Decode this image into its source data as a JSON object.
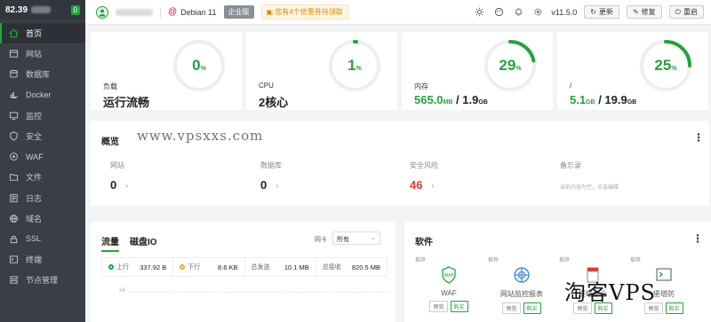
{
  "sidebar": {
    "ip": "82.39",
    "badge": "0",
    "items": [
      {
        "label": "首页",
        "icon": "home-icon"
      },
      {
        "label": "网站",
        "icon": "globe-icon"
      },
      {
        "label": "数据库",
        "icon": "database-icon"
      },
      {
        "label": "Docker",
        "icon": "docker-icon"
      },
      {
        "label": "监控",
        "icon": "monitor-icon"
      },
      {
        "label": "安全",
        "icon": "shield-icon"
      },
      {
        "label": "WAF",
        "icon": "waf-icon"
      },
      {
        "label": "文件",
        "icon": "folder-icon"
      },
      {
        "label": "日志",
        "icon": "log-icon"
      },
      {
        "label": "域名",
        "icon": "domain-icon"
      },
      {
        "label": "SSL",
        "icon": "ssl-icon"
      },
      {
        "label": "终端",
        "icon": "terminal-icon"
      },
      {
        "label": "节点管理",
        "icon": "node-icon"
      }
    ]
  },
  "topbar": {
    "os": "Debian 11",
    "edition": "企业版",
    "notice": "您有4个优惠券待领取",
    "version": "v11.5.0",
    "update": "更新",
    "repair": "修复",
    "restart": "重启"
  },
  "stats": {
    "load": {
      "label": "负载",
      "value": "运行流畅",
      "percent": "0",
      "unit": "%"
    },
    "cpu": {
      "label": "CPU",
      "value": "2核心",
      "percent": "1",
      "unit": "%"
    },
    "memory": {
      "label": "内存",
      "used": "565.0",
      "used_unit": "MB",
      "sep": " / ",
      "total": "1.9",
      "total_unit": "GB",
      "percent": "29",
      "unit": "%"
    },
    "disk": {
      "label": "/",
      "used": "5.1",
      "used_unit": "GB",
      "sep": " / ",
      "total": "19.9",
      "total_unit": "GB",
      "percent": "25",
      "unit": "%"
    }
  },
  "overview": {
    "title": "概览",
    "watermark": "www.vpsxxs.com",
    "items": [
      {
        "label": "网站",
        "value": "0"
      },
      {
        "label": "数据库",
        "value": "0"
      },
      {
        "label": "安全风险",
        "value": "46"
      },
      {
        "label": "备忘录",
        "hint": "当前内容为空，点击编辑"
      }
    ]
  },
  "traffic": {
    "tab_traffic": "流量",
    "tab_disk": "磁盘IO",
    "nic_label": "网卡",
    "nic_value": "所有",
    "up_label": "上行",
    "up_value": "337.92 B",
    "down_label": "下行",
    "down_value": "8.6 KB",
    "sent_label": "总发送",
    "sent_value": "10.1 MB",
    "recv_label": "总接收",
    "recv_value": "820.5 MB",
    "axis_tick": "24"
  },
  "software": {
    "title": "软件",
    "recommend": "推荐",
    "items": [
      {
        "name": "WAF",
        "preview": "预览",
        "buy": "购买"
      },
      {
        "name": "网站监控报表",
        "preview": "预览",
        "buy": "购买"
      },
      {
        "name": "堡塔企业",
        "preview": "预览",
        "buy": "购买"
      },
      {
        "name": "堡塔防",
        "preview": "预览",
        "buy": "购买"
      }
    ],
    "watermark": "淘客VPS"
  },
  "colors": {
    "accent": "#20a53a",
    "sidebar": "#3a3f45",
    "danger": "#e53935"
  }
}
